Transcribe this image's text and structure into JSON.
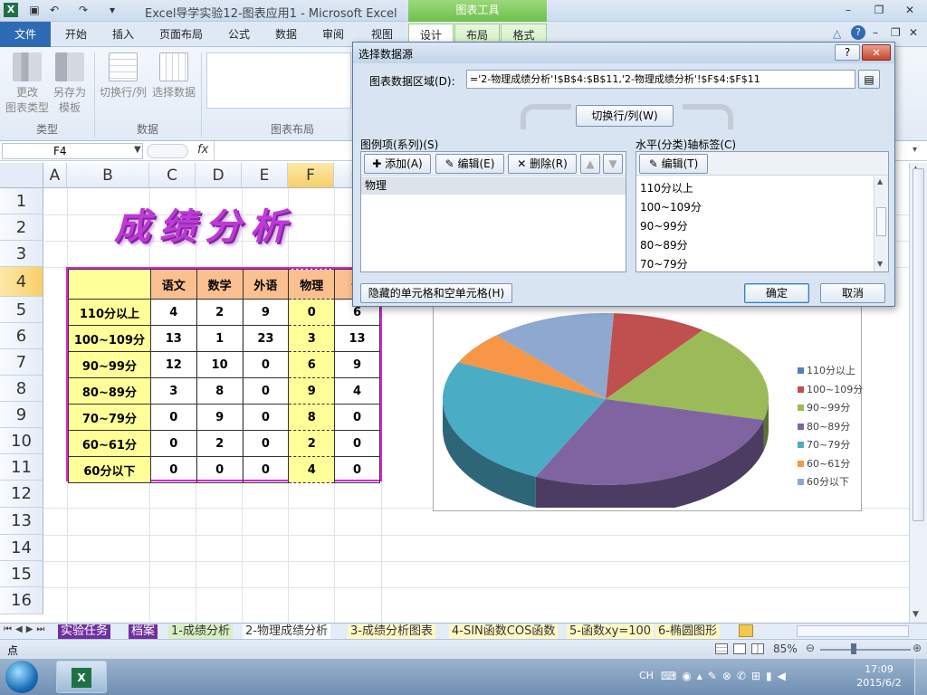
{
  "window": {
    "title": "Excel导学实验12-图表应用1 - Microsoft Excel",
    "chart_tools_label": "图表工具",
    "excel_icon": "X",
    "qat_icons": [
      "save-icon",
      "undo-icon",
      "redo-icon"
    ]
  },
  "ribbon": {
    "tabs": [
      "文件",
      "开始",
      "插入",
      "页面布局",
      "公式",
      "数据",
      "审阅",
      "视图",
      "设计",
      "布局",
      "格式"
    ],
    "change_type": "更改\n图表类型",
    "save_template": "另存为\n模板",
    "switch_rowcol": "切换行/列",
    "select_data": "选择数据",
    "group_type": "类型",
    "group_data": "数据",
    "group_layout": "图表布局"
  },
  "formula_bar": {
    "name_box": "F4",
    "fx": "fx",
    "value": ""
  },
  "sheet": {
    "columns": [
      "A",
      "B",
      "C",
      "D",
      "E",
      "F",
      "G"
    ],
    "rows": [
      "1",
      "2",
      "3",
      "4",
      "5",
      "6",
      "7",
      "8",
      "9",
      "10",
      "11",
      "12",
      "13",
      "14",
      "15",
      "16"
    ],
    "wordart": "成绩分析",
    "table_header": [
      "",
      "语文",
      "数学",
      "外语",
      "物理",
      "化"
    ],
    "table_rows": [
      [
        "110分以上",
        "4",
        "2",
        "9",
        "0",
        "6"
      ],
      [
        "100~109分",
        "13",
        "1",
        "23",
        "3",
        "13"
      ],
      [
        "90~99分",
        "12",
        "10",
        "0",
        "6",
        "9"
      ],
      [
        "80~89分",
        "3",
        "8",
        "0",
        "9",
        "4"
      ],
      [
        "70~79分",
        "0",
        "9",
        "0",
        "8",
        "0"
      ],
      [
        "60~61分",
        "0",
        "2",
        "0",
        "2",
        "0"
      ],
      [
        "60分以下",
        "0",
        "0",
        "0",
        "4",
        "0"
      ]
    ]
  },
  "chart": {
    "legend": [
      "110分以上",
      "100~109分",
      "90~99分",
      "80~89分",
      "70~79分",
      "60~61分",
      "60分以下"
    ],
    "colors": [
      "#4f81bd",
      "#c0504d",
      "#9bbb59",
      "#8064a2",
      "#4bacc6",
      "#f79646",
      "#8fa8d0"
    ]
  },
  "chart_data": {
    "type": "pie",
    "categories": [
      "110分以上",
      "100~109分",
      "90~99分",
      "80~89分",
      "70~79分",
      "60~61分",
      "60分以下"
    ],
    "values": [
      0,
      3,
      6,
      9,
      8,
      2,
      4
    ]
  },
  "dialog": {
    "title": "选择数据源",
    "range_label": "图表数据区域(D):",
    "range_value": "='2-物理成绩分析'!$B$4:$B$11,'2-物理成绩分析'!$F$4:$F$11",
    "switch_button": "切换行/列(W)",
    "series_label": "图例项(系列)(S)",
    "add_button": "添加(A)",
    "edit_button": "编辑(E)",
    "delete_button": "删除(R)",
    "series_items": [
      "物理"
    ],
    "axis_label": "水平(分类)轴标签(C)",
    "axis_edit_button": "编辑(T)",
    "axis_items": [
      "110分以上",
      "100~109分",
      "90~99分",
      "80~89分",
      "70~79分"
    ],
    "hidden_button": "隐藏的单元格和空单元格(H)",
    "ok_button": "确定",
    "cancel_button": "取消",
    "help": "?",
    "close": "✕"
  },
  "sheet_tabs": [
    "实验任务",
    "档案",
    "1-成绩分析",
    "2-物理成绩分析",
    "3-成绩分析图表",
    "4-SIN函数COS函数",
    "5-函数xy=100",
    "6-椭圆图形"
  ],
  "status": {
    "mode": "点",
    "zoom": "85%"
  },
  "taskbar": {
    "lang": "CH",
    "time": "17:09",
    "date": "2015/6/2"
  }
}
